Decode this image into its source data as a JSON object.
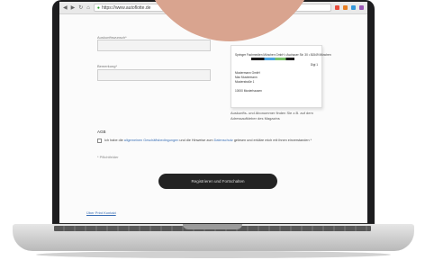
{
  "browser": {
    "url": "https://www.autoflotte.de",
    "icons": [
      "back-icon",
      "forward-icon",
      "reload-icon",
      "home-icon"
    ],
    "extension_colors": [
      "#e74c3c",
      "#e67e22",
      "#3498db",
      "#9b59b6"
    ]
  },
  "form": {
    "field1_label": "Auskunftswunsch*",
    "field2_label": "Bemerkung*",
    "section_title": "AGB",
    "consent_text_before": "Ich habe die",
    "consent_link1": "allgemeinen Geschäftsbedingungen",
    "consent_text_middle": "und die Hinweise zum",
    "consent_link2": "Datenschutz",
    "consent_text_after": "gelesen und erkläre mich mit ihnen einverstanden *",
    "required_note": "* Pflichtfelder",
    "submit_label": "Registrieren und Fortschalten",
    "footer_link": "Über Print Kontakt"
  },
  "envelope": {
    "sender_line": "Springer Fachmedien München GmbH • Aschauer Str. 30 • 81549 München",
    "code": "Digi 1",
    "recipient_lines": [
      "Mustermann GmbH",
      "Max Mustermann",
      "Musterstraße 1",
      "",
      "10000 Musterhausen"
    ]
  },
  "hint_text": "Auskunfts- und Abonummer finden Sie z.B. auf dem Adressaufkleber des Magazins",
  "decor": {
    "blob_color": "#d9a48f"
  }
}
